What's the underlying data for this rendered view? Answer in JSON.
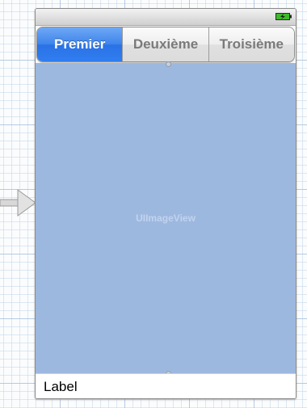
{
  "segmented_control": {
    "segments": [
      {
        "label": "Premier",
        "selected": true
      },
      {
        "label": "Deuxième",
        "selected": false
      },
      {
        "label": "Troisième",
        "selected": false
      }
    ]
  },
  "image_view": {
    "placeholder": "UIImageView"
  },
  "label": {
    "text": "Label"
  },
  "status_bar": {
    "icon": "battery-charging-icon"
  },
  "entry_point": {
    "icon": "entry-arrow-icon"
  },
  "colors": {
    "selected_segment": "#2f7ef0",
    "image_view_bg": "#9db8df",
    "battery": "#3dbb2a"
  }
}
